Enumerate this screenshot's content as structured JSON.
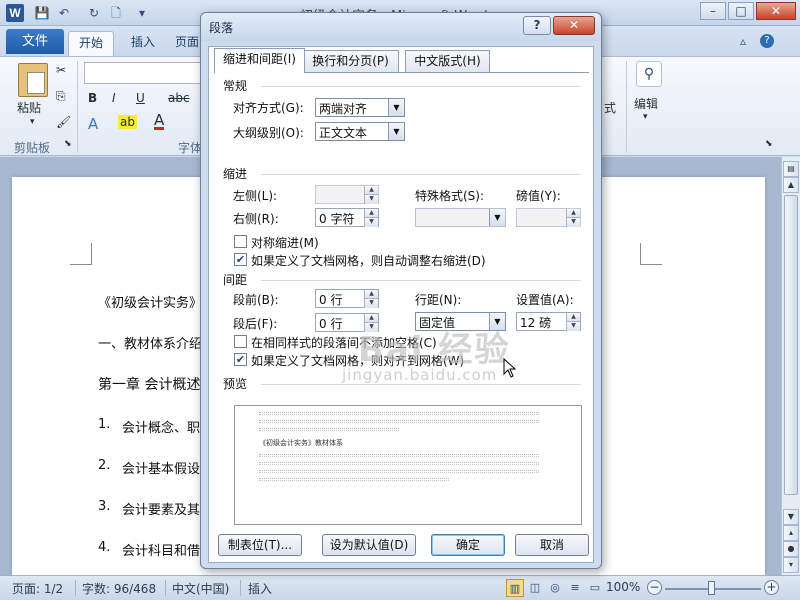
{
  "window": {
    "title": "初级会计实务 - Microsoft Word",
    "logo_letter": "W",
    "controls": {
      "minimize": "–",
      "maximize": "□",
      "close": "✕"
    }
  },
  "quick_access": {
    "save": "💾",
    "undo": "↶",
    "redo": "↻",
    "new": "🗋",
    "customize": "▾"
  },
  "ribbon_tabs": [
    {
      "label": "文件"
    },
    {
      "label": "开始"
    },
    {
      "label": "插入"
    },
    {
      "label": "页面"
    }
  ],
  "ribbon": {
    "paste_label": "粘贴",
    "clipboard_group": "剪贴板",
    "font_group": "字体",
    "bold": "B",
    "italic": "I",
    "underline": "U",
    "strike": "abc",
    "sub": "x₂",
    "text_effect": "A",
    "highlight": "ab",
    "font_color": "A",
    "style_partial": "式",
    "edit_label": "编辑"
  },
  "document": {
    "lines": [
      "《初级会计实务》教材",
      "一、教材体系介绍",
      "第一章  会计概述 《"
    ],
    "numbered": [
      {
        "num": "1.",
        "text": "会计概念、职能"
      },
      {
        "num": "2.",
        "text": "会计基本假设、"
      },
      {
        "num": "3.",
        "text": "会计要素及其确"
      },
      {
        "num": "4.",
        "text": "会计科目和借贷"
      }
    ]
  },
  "status_bar": {
    "page": "页面: 1/2",
    "words": "字数: 96/468",
    "language": "中文(中国)",
    "insert_mode": "插入",
    "zoom": "100%",
    "zoom_minus": "−",
    "zoom_plus": "+"
  },
  "dialog": {
    "title": "段落",
    "help": "?",
    "close": "✕",
    "tabs": [
      "缩进和间距(I)",
      "换行和分页(P)",
      "中文版式(H)"
    ],
    "general": {
      "heading": "常规",
      "alignment_label": "对齐方式(G):",
      "alignment_value": "两端对齐",
      "outline_label": "大纲级别(O):",
      "outline_value": "正文文本"
    },
    "indent": {
      "heading": "缩进",
      "left_label": "左侧(L):",
      "left_value": "",
      "right_label": "右侧(R):",
      "right_value": "0 字符",
      "special_label": "特殊格式(S):",
      "special_value": "",
      "by_label": "磅值(Y):",
      "by_value": "",
      "mirror_label": "对称缩进(M)",
      "mirror_checked": false,
      "auto_adjust_label": "如果定义了文档网格，则自动调整右缩进(D)",
      "auto_adjust_checked": true
    },
    "spacing": {
      "heading": "间距",
      "before_label": "段前(B):",
      "before_value": "0 行",
      "after_label": "段后(F):",
      "after_value": "0 行",
      "line_label": "行距(N):",
      "line_value": "固定值",
      "at_label": "设置值(A):",
      "at_value": "12 磅",
      "no_space_label": "在相同样式的段落间不添加空格(C)",
      "no_space_checked": false,
      "snap_grid_label": "如果定义了文档网格，则对齐到网格(W)",
      "snap_grid_checked": true
    },
    "preview": {
      "heading": "预览",
      "sample_text": "《初级会计实务》教材体系"
    },
    "buttons": {
      "tabs": "制表位(T)...",
      "set_default": "设为默认值(D)",
      "ok": "确定",
      "cancel": "取消"
    }
  },
  "watermark": {
    "main": "Bai 经验",
    "sub": "jingyan.baidu.com"
  },
  "colors": {
    "accent": "#1f5ba6",
    "dialog_bg": "#cfdced",
    "close_red": "#c8432b"
  }
}
